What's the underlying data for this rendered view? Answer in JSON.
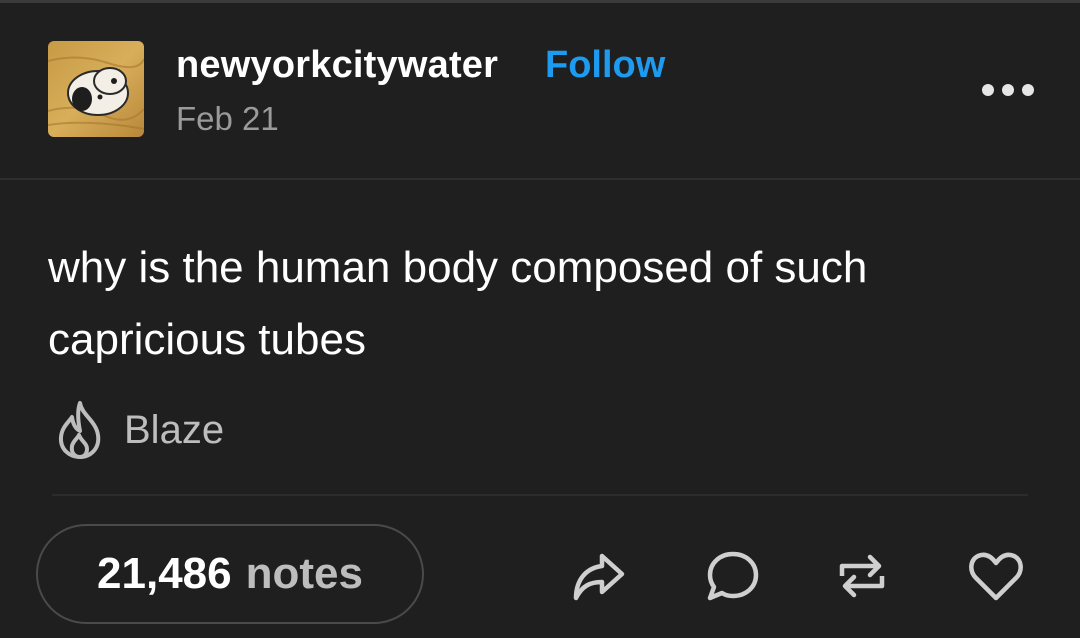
{
  "post": {
    "author": "newyorkcitywater",
    "follow_label": "Follow",
    "date": "Feb 21",
    "text": "why is the human body composed of such capricious tubes",
    "blaze_label": "Blaze",
    "notes_count": "21,486",
    "notes_label": "notes"
  },
  "colors": {
    "background": "#1f1f1f",
    "follow": "#1d9bf0",
    "muted_text": "#9a9a9a",
    "icon": "#cfcfcf"
  },
  "icons": {
    "more": "more-dots-icon",
    "blaze": "flame-icon",
    "share": "share-arrow-icon",
    "reply": "speech-bubble-icon",
    "reblog": "reblog-icon",
    "like": "heart-icon"
  }
}
